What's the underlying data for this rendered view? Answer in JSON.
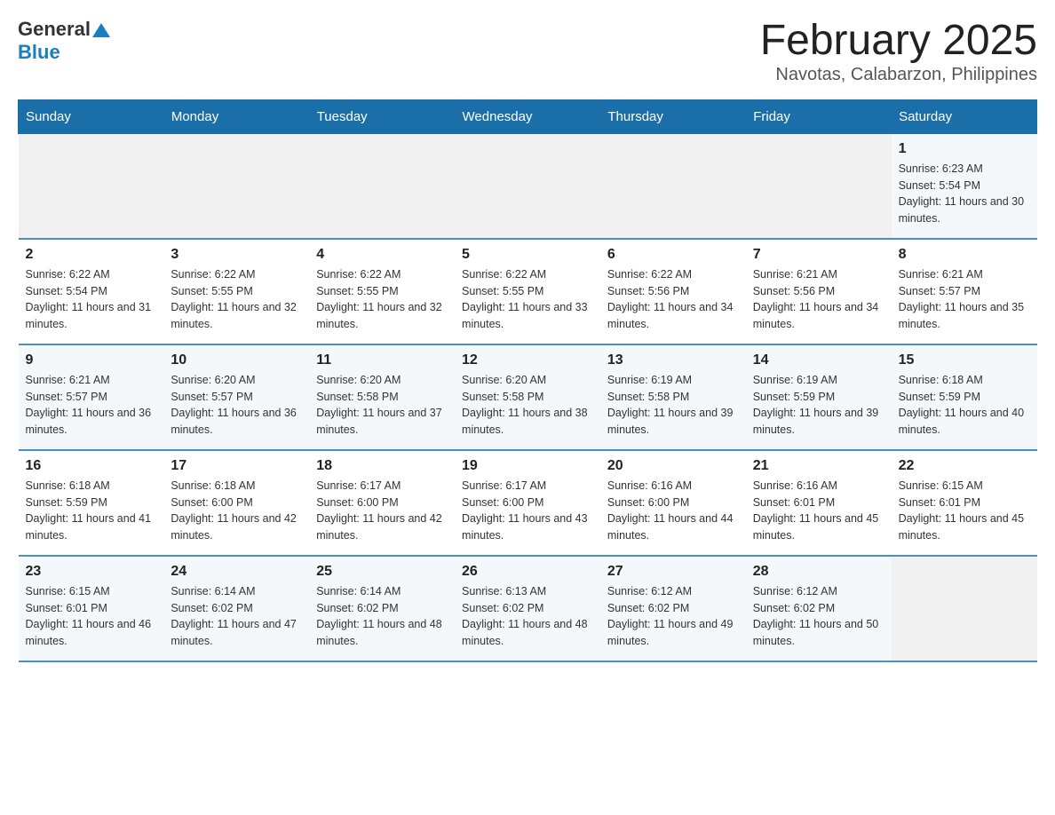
{
  "header": {
    "logo_general": "General",
    "logo_blue": "Blue",
    "title": "February 2025",
    "subtitle": "Navotas, Calabarzon, Philippines"
  },
  "days_of_week": [
    "Sunday",
    "Monday",
    "Tuesday",
    "Wednesday",
    "Thursday",
    "Friday",
    "Saturday"
  ],
  "weeks": [
    [
      {
        "day": "",
        "info": ""
      },
      {
        "day": "",
        "info": ""
      },
      {
        "day": "",
        "info": ""
      },
      {
        "day": "",
        "info": ""
      },
      {
        "day": "",
        "info": ""
      },
      {
        "day": "",
        "info": ""
      },
      {
        "day": "1",
        "info": "Sunrise: 6:23 AM\nSunset: 5:54 PM\nDaylight: 11 hours and 30 minutes."
      }
    ],
    [
      {
        "day": "2",
        "info": "Sunrise: 6:22 AM\nSunset: 5:54 PM\nDaylight: 11 hours and 31 minutes."
      },
      {
        "day": "3",
        "info": "Sunrise: 6:22 AM\nSunset: 5:55 PM\nDaylight: 11 hours and 32 minutes."
      },
      {
        "day": "4",
        "info": "Sunrise: 6:22 AM\nSunset: 5:55 PM\nDaylight: 11 hours and 32 minutes."
      },
      {
        "day": "5",
        "info": "Sunrise: 6:22 AM\nSunset: 5:55 PM\nDaylight: 11 hours and 33 minutes."
      },
      {
        "day": "6",
        "info": "Sunrise: 6:22 AM\nSunset: 5:56 PM\nDaylight: 11 hours and 34 minutes."
      },
      {
        "day": "7",
        "info": "Sunrise: 6:21 AM\nSunset: 5:56 PM\nDaylight: 11 hours and 34 minutes."
      },
      {
        "day": "8",
        "info": "Sunrise: 6:21 AM\nSunset: 5:57 PM\nDaylight: 11 hours and 35 minutes."
      }
    ],
    [
      {
        "day": "9",
        "info": "Sunrise: 6:21 AM\nSunset: 5:57 PM\nDaylight: 11 hours and 36 minutes."
      },
      {
        "day": "10",
        "info": "Sunrise: 6:20 AM\nSunset: 5:57 PM\nDaylight: 11 hours and 36 minutes."
      },
      {
        "day": "11",
        "info": "Sunrise: 6:20 AM\nSunset: 5:58 PM\nDaylight: 11 hours and 37 minutes."
      },
      {
        "day": "12",
        "info": "Sunrise: 6:20 AM\nSunset: 5:58 PM\nDaylight: 11 hours and 38 minutes."
      },
      {
        "day": "13",
        "info": "Sunrise: 6:19 AM\nSunset: 5:58 PM\nDaylight: 11 hours and 39 minutes."
      },
      {
        "day": "14",
        "info": "Sunrise: 6:19 AM\nSunset: 5:59 PM\nDaylight: 11 hours and 39 minutes."
      },
      {
        "day": "15",
        "info": "Sunrise: 6:18 AM\nSunset: 5:59 PM\nDaylight: 11 hours and 40 minutes."
      }
    ],
    [
      {
        "day": "16",
        "info": "Sunrise: 6:18 AM\nSunset: 5:59 PM\nDaylight: 11 hours and 41 minutes."
      },
      {
        "day": "17",
        "info": "Sunrise: 6:18 AM\nSunset: 6:00 PM\nDaylight: 11 hours and 42 minutes."
      },
      {
        "day": "18",
        "info": "Sunrise: 6:17 AM\nSunset: 6:00 PM\nDaylight: 11 hours and 42 minutes."
      },
      {
        "day": "19",
        "info": "Sunrise: 6:17 AM\nSunset: 6:00 PM\nDaylight: 11 hours and 43 minutes."
      },
      {
        "day": "20",
        "info": "Sunrise: 6:16 AM\nSunset: 6:00 PM\nDaylight: 11 hours and 44 minutes."
      },
      {
        "day": "21",
        "info": "Sunrise: 6:16 AM\nSunset: 6:01 PM\nDaylight: 11 hours and 45 minutes."
      },
      {
        "day": "22",
        "info": "Sunrise: 6:15 AM\nSunset: 6:01 PM\nDaylight: 11 hours and 45 minutes."
      }
    ],
    [
      {
        "day": "23",
        "info": "Sunrise: 6:15 AM\nSunset: 6:01 PM\nDaylight: 11 hours and 46 minutes."
      },
      {
        "day": "24",
        "info": "Sunrise: 6:14 AM\nSunset: 6:02 PM\nDaylight: 11 hours and 47 minutes."
      },
      {
        "day": "25",
        "info": "Sunrise: 6:14 AM\nSunset: 6:02 PM\nDaylight: 11 hours and 48 minutes."
      },
      {
        "day": "26",
        "info": "Sunrise: 6:13 AM\nSunset: 6:02 PM\nDaylight: 11 hours and 48 minutes."
      },
      {
        "day": "27",
        "info": "Sunrise: 6:12 AM\nSunset: 6:02 PM\nDaylight: 11 hours and 49 minutes."
      },
      {
        "day": "28",
        "info": "Sunrise: 6:12 AM\nSunset: 6:02 PM\nDaylight: 11 hours and 50 minutes."
      },
      {
        "day": "",
        "info": ""
      }
    ]
  ]
}
